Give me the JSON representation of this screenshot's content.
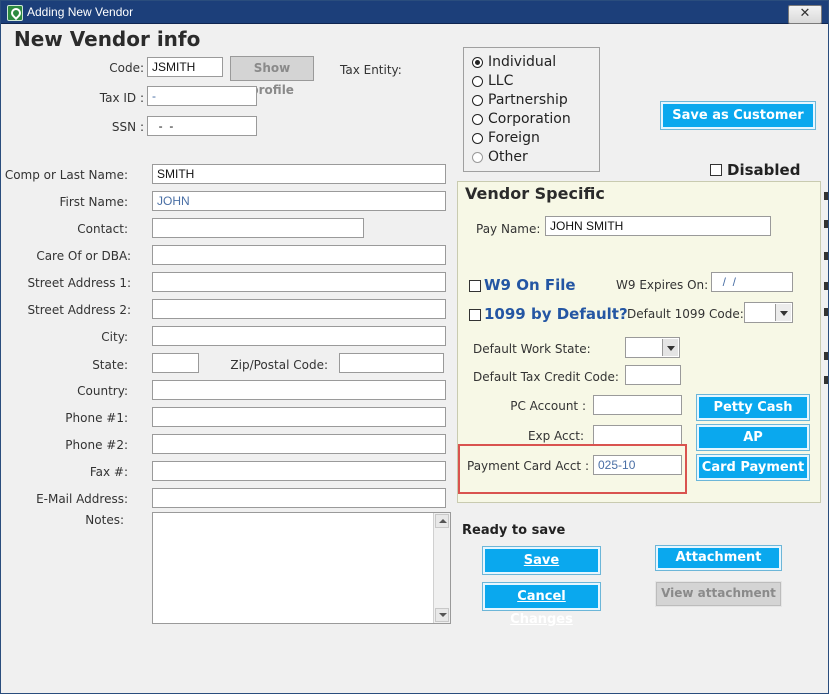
{
  "window": {
    "title": "Adding New Vendor",
    "close_glyph": "✕"
  },
  "heading": "New Vendor info",
  "code": {
    "label": "Code:",
    "value": "JSMITH",
    "show_profile": "Show profile"
  },
  "tax_entity": {
    "label": "Tax Entity:",
    "options": [
      "Individual",
      "LLC",
      "Partnership",
      "Corporation",
      "Foreign",
      "Other"
    ],
    "selected": "Individual"
  },
  "tax_id": {
    "label": "Tax ID :",
    "value": " -"
  },
  "ssn": {
    "label": "SSN :",
    "value": "  -  -"
  },
  "fields": {
    "last_name": {
      "label": "Comp or Last Name:",
      "value": "SMITH"
    },
    "first_name": {
      "label": "First Name:",
      "value": "JOHN"
    },
    "contact": {
      "label": "Contact:",
      "value": ""
    },
    "care_of": {
      "label": "Care Of or DBA:",
      "value": ""
    },
    "street1": {
      "label": "Street Address 1:",
      "value": ""
    },
    "street2": {
      "label": "Street Address 2:",
      "value": ""
    },
    "city": {
      "label": "City:",
      "value": ""
    },
    "state": {
      "label": "State:",
      "value": ""
    },
    "zip": {
      "label": "Zip/Postal Code:",
      "value": ""
    },
    "country": {
      "label": "Country:",
      "value": ""
    },
    "phone1": {
      "label": "Phone #1:",
      "value": ""
    },
    "phone2": {
      "label": "Phone #2:",
      "value": ""
    },
    "fax": {
      "label": "Fax #:",
      "value": ""
    },
    "email": {
      "label": "E-Mail Address:",
      "value": ""
    },
    "notes": {
      "label": "Notes:",
      "value": ""
    }
  },
  "save_as_customer": "Save as Customer",
  "disabled_label": "Disabled",
  "vendor_specific": {
    "title": "Vendor Specific",
    "pay_name": {
      "label": "Pay Name:",
      "value": "JOHN SMITH"
    },
    "w9": {
      "label": "W9 On File",
      "expires_label": "W9 Expires On:",
      "expires_value": "  /  /"
    },
    "form1099": {
      "label": "1099 by Default?",
      "code_label": "Default 1099 Code:",
      "code_value": ""
    },
    "work_state": {
      "label": "Default Work State:",
      "value": ""
    },
    "tax_credit": {
      "label": "Default Tax Credit Code:",
      "value": ""
    },
    "pc_account": {
      "label": "PC Account :",
      "value": ""
    },
    "exp_acct": {
      "label": "Exp Acct:",
      "value": ""
    },
    "payment_card": {
      "label": "Payment Card Acct :",
      "value": "025-10"
    },
    "buttons": {
      "petty_cash": "Petty Cash",
      "ap": "AP",
      "card_payment": "Card Payment"
    }
  },
  "status": "Ready to save",
  "actions": {
    "save": "Save",
    "cancel": "Cancel Changes",
    "attachment": "Attachment",
    "view_attachment": "View attachment"
  }
}
